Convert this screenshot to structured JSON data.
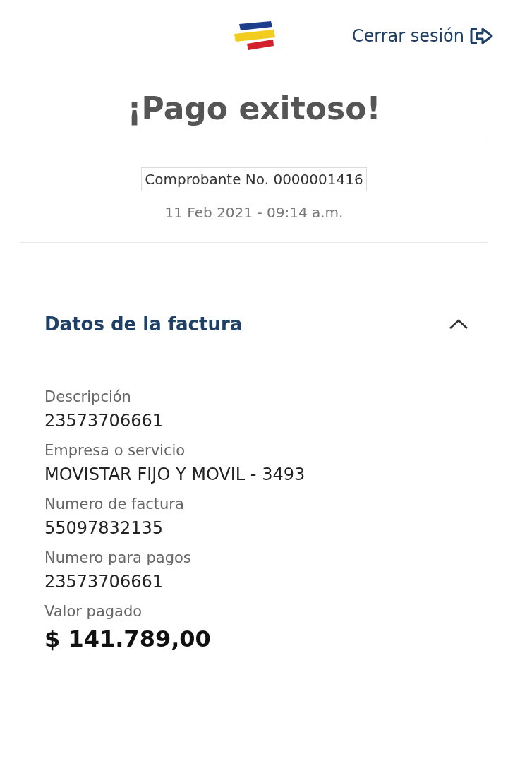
{
  "header": {
    "logout": "Cerrar sesión"
  },
  "title": "¡Pago exitoso!",
  "receipt": {
    "number": "Comprobante No. 0000001416",
    "date": "11 Feb 2021 - 09:14 a.m."
  },
  "section": {
    "title": "Datos de la factura",
    "expanded": true
  },
  "fields": [
    {
      "label": "Descripción",
      "value": "23573706661",
      "kind": "plain"
    },
    {
      "label": "Empresa o servicio",
      "value": "MOVISTAR FIJO Y MOVIL - 3493",
      "kind": "plain"
    },
    {
      "label": "Numero de factura",
      "value": "55097832135",
      "kind": "plain"
    },
    {
      "label": "Numero para pagos",
      "value": "23573706661",
      "kind": "plain"
    },
    {
      "label": "Valor pagado",
      "value": "$ 141.789,00",
      "kind": "total"
    }
  ]
}
